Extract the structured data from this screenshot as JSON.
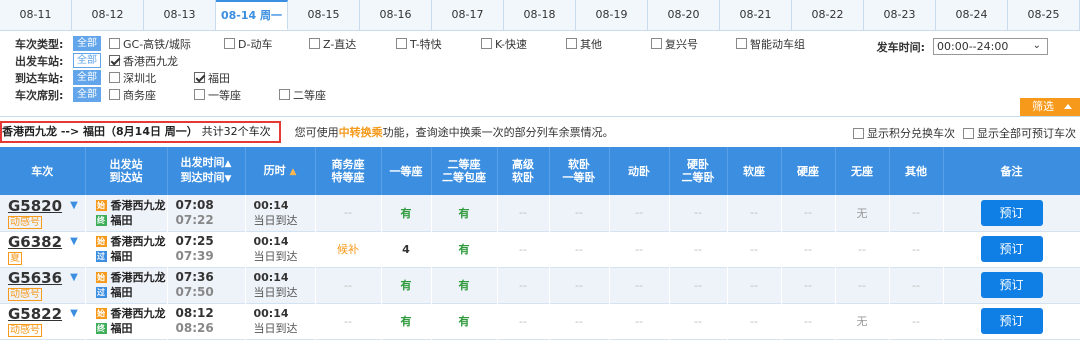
{
  "date_tabs": [
    "08-11",
    "08-12",
    "08-13",
    "08-14 周一",
    "08-15",
    "08-16",
    "08-17",
    "08-18",
    "08-19",
    "08-20",
    "08-21",
    "08-22",
    "08-23",
    "08-24",
    "08-25"
  ],
  "active_tab": 3,
  "filters": {
    "train_type_label": "车次类型:",
    "all_label": "全部",
    "train_types": [
      "GC-高铁/城际",
      "D-动车",
      "Z-直达",
      "T-特快",
      "K-快速",
      "其他",
      "复兴号",
      "智能动车组"
    ],
    "depart_station_label": "出发车站:",
    "depart_stations": [
      "香港西九龙"
    ],
    "arrive_station_label": "到达车站:",
    "arrive_stations": [
      "深圳北",
      "福田"
    ],
    "seat_class_label": "车次席别:",
    "seat_classes": [
      "商务座",
      "一等座",
      "二等座"
    ],
    "depart_time_label": "发车时间:",
    "depart_time_value": "00:00--24:00",
    "filter_button": "筛选"
  },
  "summary": {
    "route": "香港西九龙 --> 福田（8月14日  周一）",
    "count_text": "共计32个车次",
    "hint_prefix": "您可使用",
    "hint_link": "中转换乘",
    "hint_suffix": "功能，查询途中换乘一次的部分列车余票情况。",
    "opt1": "显示积分兑换车次",
    "opt2": "显示全部可预订车次"
  },
  "table": {
    "headers": {
      "train": "车次",
      "stations_1": "出发站",
      "stations_2": "到达站",
      "times_1": "出发时间",
      "times_2": "到达时间",
      "duration": "历时",
      "business_1": "商务座",
      "business_2": "特等座",
      "first": "一等座",
      "second_1": "二等座",
      "second_2": "二等包座",
      "highsoft_1": "高级",
      "highsoft_2": "软卧",
      "softbed_1": "软卧",
      "softbed_2": "一等卧",
      "dongwo": "动卧",
      "hardbed_1": "硬卧",
      "hardbed_2": "二等卧",
      "softseat": "软座",
      "hardseat": "硬座",
      "noseat": "无座",
      "other": "其他",
      "remark": "备注"
    },
    "rows": [
      {
        "train": "G5820",
        "tag": "动感号",
        "from_badge": "始",
        "from": "香港西九龙",
        "to_badge": "终",
        "to": "福田",
        "dep": "07:08",
        "arr": "07:22",
        "dur": "00:14",
        "dur_sub": "当日到达",
        "business": "--",
        "first": "有",
        "second": "有",
        "highsoft": "--",
        "softbed": "--",
        "dongwo": "--",
        "hardbed": "--",
        "softseat": "--",
        "hardseat": "--",
        "noseat": "无",
        "other": "--",
        "book": "预订"
      },
      {
        "train": "G6382",
        "tag": "夏",
        "from_badge": "始",
        "from": "香港西九龙",
        "to_badge": "过",
        "to": "福田",
        "dep": "07:25",
        "arr": "07:39",
        "dur": "00:14",
        "dur_sub": "当日到达",
        "business": "候补",
        "first": "4",
        "second": "有",
        "highsoft": "--",
        "softbed": "--",
        "dongwo": "--",
        "hardbed": "--",
        "softseat": "--",
        "hardseat": "--",
        "noseat": "--",
        "other": "--",
        "book": "预订"
      },
      {
        "train": "G5636",
        "tag": "动感号",
        "from_badge": "始",
        "from": "香港西九龙",
        "to_badge": "过",
        "to": "福田",
        "dep": "07:36",
        "arr": "07:50",
        "dur": "00:14",
        "dur_sub": "当日到达",
        "business": "--",
        "first": "有",
        "second": "有",
        "highsoft": "--",
        "softbed": "--",
        "dongwo": "--",
        "hardbed": "--",
        "softseat": "--",
        "hardseat": "--",
        "noseat": "--",
        "other": "--",
        "book": "预订"
      },
      {
        "train": "G5822",
        "tag": "动感号",
        "from_badge": "始",
        "from": "香港西九龙",
        "to_badge": "终",
        "to": "福田",
        "dep": "08:12",
        "arr": "08:26",
        "dur": "00:14",
        "dur_sub": "当日到达",
        "business": "--",
        "first": "有",
        "second": "有",
        "highsoft": "--",
        "softbed": "--",
        "dongwo": "--",
        "hardbed": "--",
        "softseat": "--",
        "hardseat": "--",
        "noseat": "无",
        "other": "--",
        "book": "预订"
      }
    ]
  },
  "colors": {
    "accent": "#3b8ee0",
    "orange": "#f79a1c",
    "green": "#2e9a3c",
    "red_border": "#e53935"
  }
}
